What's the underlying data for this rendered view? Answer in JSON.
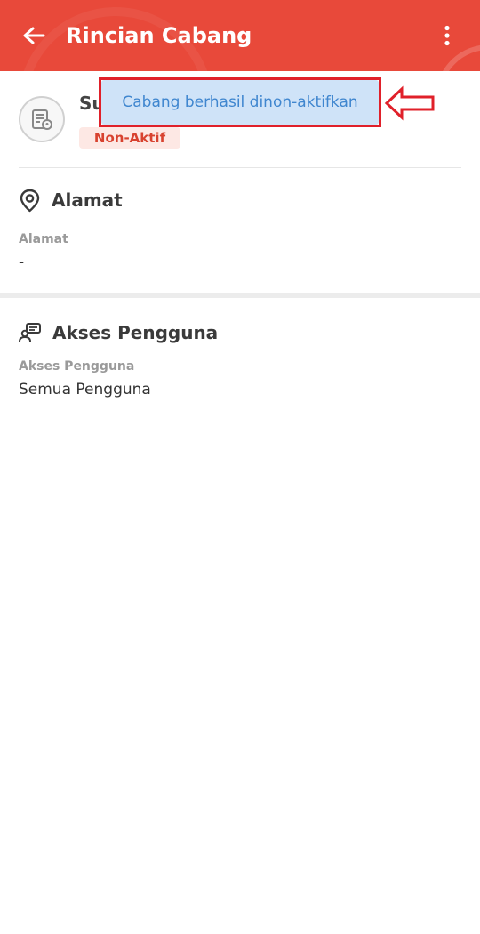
{
  "appbar": {
    "title": "Rincian Cabang",
    "back_icon": "arrow-left-icon",
    "menu_icon": "more-vertical-icon",
    "color": "#e8493a"
  },
  "branch": {
    "name_visible": "Su",
    "status": "Non-Aktif",
    "status_color": "#d8422f",
    "status_bg": "#fde8e4"
  },
  "address_section": {
    "title": "Alamat",
    "icon": "location-pin-icon",
    "field_label": "Alamat",
    "field_value": "-"
  },
  "access_section": {
    "title": "Akses Pengguna",
    "icon": "user-chat-icon",
    "field_label": "Akses Pengguna",
    "field_value": "Semua Pengguna"
  },
  "toast": {
    "message": "Cabang berhasil dinon-aktifkan",
    "bg": "#cfe3f8",
    "text_color": "#3f86cf"
  },
  "annotation": {
    "color": "#e0202a",
    "arrow_icon": "arrow-left-outline-icon"
  }
}
